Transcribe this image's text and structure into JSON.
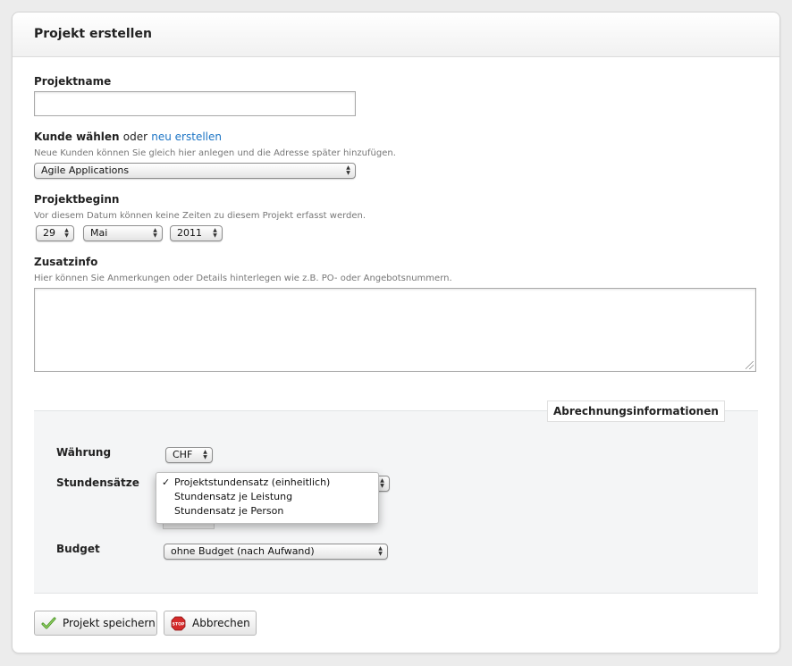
{
  "page": {
    "title": "Projekt erstellen"
  },
  "form": {
    "project_name": {
      "label": "Projektname",
      "value": "",
      "placeholder": ""
    },
    "customer": {
      "label": "Kunde wählen",
      "or_text": "oder",
      "create_link": "neu erstellen",
      "hint": "Neue Kunden können Sie gleich hier anlegen und die Adresse später hinzufügen.",
      "selected": "Agile Applications"
    },
    "start": {
      "label": "Projektbeginn",
      "hint": "Vor diesem Datum können keine Zeiten zu diesem Projekt erfasst werden.",
      "day": "29",
      "month": "Mai",
      "year": "2011"
    },
    "notes": {
      "label": "Zusatzinfo",
      "hint": "Hier können Sie Anmerkungen oder Details hinterlegen wie z.B. PO- oder Angebotsnummern.",
      "value": ""
    }
  },
  "billing": {
    "legend": "Abrechnungsinformationen",
    "currency": {
      "label": "Währung",
      "selected": "CHF"
    },
    "hourly_rates": {
      "label": "Stundensätze",
      "check": "✓",
      "options": [
        {
          "label": "Projektstundensatz (einheitlich)",
          "checked": true
        },
        {
          "label": "Stundensatz je Leistung",
          "checked": false
        },
        {
          "label": "Stundensatz je Person",
          "checked": false
        }
      ]
    },
    "budget": {
      "label": "Budget",
      "selected": "ohne Budget (nach Aufwand)"
    }
  },
  "actions": {
    "save_label": "Projekt speichern",
    "cancel_label": "Abbrechen",
    "stop_sign_text": "STOP"
  },
  "colors": {
    "link": "#1a73c4",
    "save_icon": "#4c9a2a",
    "stop_icon": "#d42a2a"
  }
}
